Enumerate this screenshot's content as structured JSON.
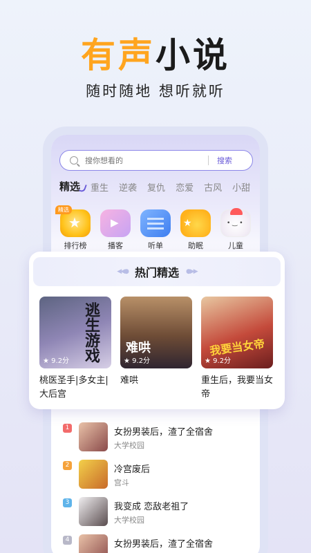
{
  "hero": {
    "title_highlight": "有声",
    "title_dark": "小说",
    "subtitle": "随时随地 想听就听"
  },
  "search": {
    "placeholder": "搜你想看的",
    "button": "搜索"
  },
  "tabs": [
    "精选",
    "重生",
    "逆袭",
    "复仇",
    "恋爱",
    "古风",
    "小甜"
  ],
  "categories": [
    {
      "label": "排行榜",
      "icon": "trophy-icon",
      "badge": "精选"
    },
    {
      "label": "播客",
      "icon": "podcast-icon"
    },
    {
      "label": "听单",
      "icon": "playlist-icon"
    },
    {
      "label": "助眠",
      "icon": "moon-icon"
    },
    {
      "label": "儿童",
      "icon": "kids-icon"
    }
  ],
  "featured": {
    "title": "热门精选",
    "books": [
      {
        "name": "桃医圣手|多女主|大后宫",
        "rating": "9.2分",
        "cover_text": "逃生游戏"
      },
      {
        "name": "难哄",
        "rating": "9.2分",
        "cover_text": "难哄"
      },
      {
        "name": "重生后，我要当女帝",
        "rating": "9.2分",
        "cover_text": "我要当女帝"
      }
    ]
  },
  "ranking": [
    {
      "rank": "1",
      "title": "女扮男装后，渣了全宿舍",
      "tag": "大学校园",
      "color": "#f26b6b"
    },
    {
      "rank": "2",
      "title": "冷宫废后",
      "tag": "宫斗",
      "color": "#f5a23b"
    },
    {
      "rank": "3",
      "title": "我变成 恋敌老祖了",
      "tag": "大学校园",
      "color": "#5fb4ea"
    },
    {
      "rank": "4",
      "title": "女扮男装后，渣了全宿舍",
      "tag": "",
      "color": "#b8b8c8"
    }
  ]
}
